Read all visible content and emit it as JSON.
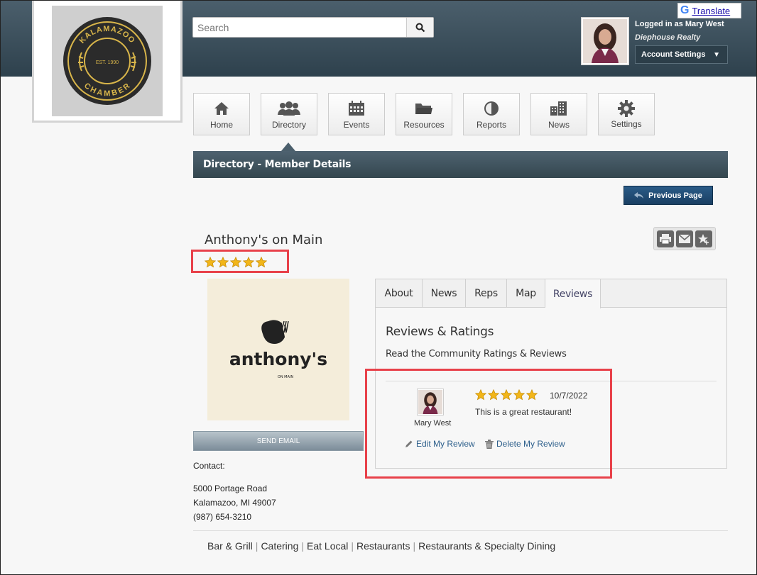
{
  "header": {
    "search_placeholder": "Search",
    "user_line": "Logged in as Mary West",
    "company": "Diephouse Realty",
    "account_settings": "Account Settings",
    "translate": "Translate",
    "logo_text_top": "KALAMAZOO",
    "logo_text_mid": "EST. 1990",
    "logo_text_bottom": "CHAMBER"
  },
  "nav": {
    "items": [
      {
        "label": "Home",
        "icon": "home-icon"
      },
      {
        "label": "Directory",
        "icon": "people-icon"
      },
      {
        "label": "Events",
        "icon": "calendar-icon"
      },
      {
        "label": "Resources",
        "icon": "folder-icon"
      },
      {
        "label": "Reports",
        "icon": "pie-chart-icon"
      },
      {
        "label": "News",
        "icon": "buildings-icon"
      },
      {
        "label": "Settings",
        "icon": "gear-icon"
      }
    ]
  },
  "section_title": "Directory - Member Details",
  "previous_page": "Previous Page",
  "business": {
    "name": "Anthony's on Main",
    "rating": 5,
    "logo_main": "anthony's",
    "logo_sub": "ON MAIN",
    "send_email": "SEND EMAIL",
    "contact_label": "Contact:",
    "address1": "5000 Portage Road",
    "address2": "Kalamazoo, MI 49007",
    "phone": "(987) 654-3210"
  },
  "tabs": [
    {
      "label": "About"
    },
    {
      "label": "News"
    },
    {
      "label": "Reps"
    },
    {
      "label": "Map"
    },
    {
      "label": "Reviews"
    }
  ],
  "reviews": {
    "title": "Reviews & Ratings",
    "subtitle": "Read the Community Ratings & Reviews",
    "item": {
      "reviewer": "Mary West",
      "rating": 5,
      "date": "10/7/2022",
      "text": "This is a great restaurant!",
      "edit": "Edit My Review",
      "delete": "Delete My Review"
    }
  },
  "categories": [
    "Bar & Grill",
    "Catering",
    "Eat Local",
    "Restaurants",
    "Restaurants & Specialty Dining"
  ],
  "colors": {
    "accent": "#1a3f63",
    "highlight": "#e8414a",
    "star": "#f2b619"
  }
}
